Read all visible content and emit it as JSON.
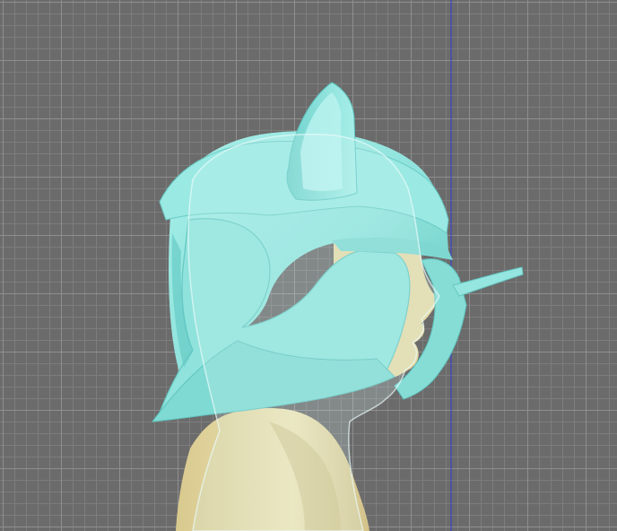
{
  "viewport": {
    "background_color": "#6b6b6b",
    "grid_minor_color": "#7d7d7d",
    "grid_major_color": "#8f8f8f",
    "axis_line_color": "#2f3bd6",
    "grid_visible": true
  },
  "model": {
    "helmet_color": "#8fe3dc",
    "helmet_shadow_color": "#5fc7c2",
    "helmet_highlight_color": "#bff3ef",
    "skin_color": "#e6d9a6",
    "skin_shadow_color": "#cdbd83",
    "overlay_outline_color": "#d9f6f4"
  }
}
